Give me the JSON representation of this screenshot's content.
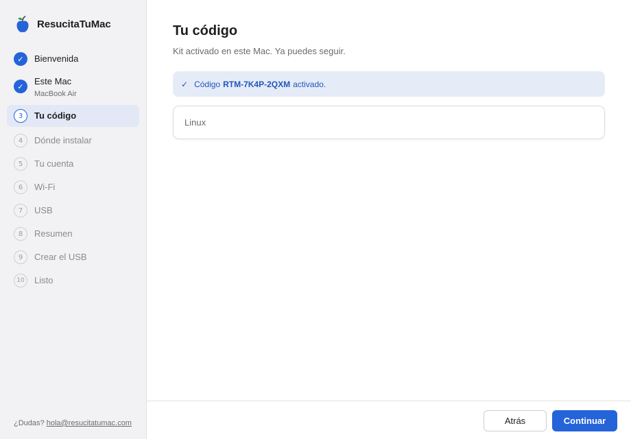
{
  "app": {
    "name": "ResucitaTuMac",
    "colors": {
      "accent": "#2563d9",
      "logo_body": "#2563d9",
      "logo_leaf": "#2e9b4f"
    }
  },
  "sidebar": {
    "steps": [
      {
        "marker": "✓",
        "label": "Bienvenida",
        "state": "done"
      },
      {
        "marker": "✓",
        "label": "Este Mac",
        "sub": "MacBook Air",
        "state": "done"
      },
      {
        "marker": "3",
        "label": "Tu código",
        "state": "active"
      },
      {
        "marker": "4",
        "label": "Dónde instalar",
        "state": "todo"
      },
      {
        "marker": "5",
        "label": "Tu cuenta",
        "state": "todo"
      },
      {
        "marker": "6",
        "label": "Wi-Fi",
        "state": "todo"
      },
      {
        "marker": "7",
        "label": "USB",
        "state": "todo"
      },
      {
        "marker": "8",
        "label": "Resumen",
        "state": "todo"
      },
      {
        "marker": "9",
        "label": "Crear el USB",
        "state": "todo"
      },
      {
        "marker": "10",
        "label": "Listo",
        "state": "todo"
      }
    ],
    "help": {
      "prefix": "¿Dudas?",
      "email": "hola@resucitatumac.com"
    }
  },
  "main": {
    "title": "Tu código",
    "subtitle": "Kit activado en este Mac. Ya puedes seguir.",
    "notice": {
      "icon": "check-icon",
      "check": "✓",
      "prefix": "Código",
      "code": "RTM-7K4P-2QXM",
      "suffix": "activado."
    },
    "os_option": "Linux"
  },
  "footer": {
    "back_label": "Atrás",
    "continue_label": "Continuar"
  }
}
